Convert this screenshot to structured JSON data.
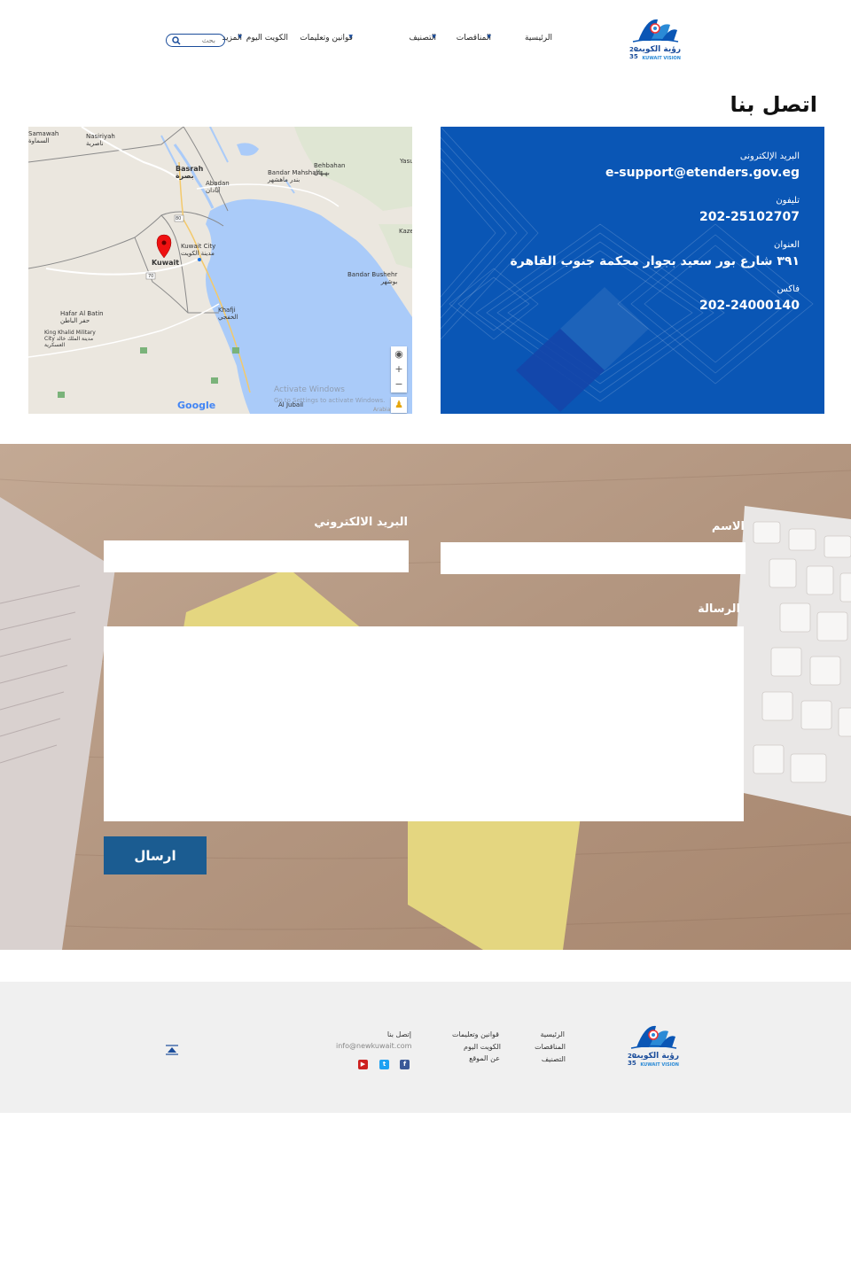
{
  "header": {
    "logo": {
      "arabic": "رؤية الكويت",
      "year_top": "20",
      "year_bottom": "35",
      "english": "KUWAIT VISION"
    },
    "nav": [
      {
        "label": "الرئيسية",
        "dropdown": false
      },
      {
        "label": "المناقصات",
        "dropdown": true
      },
      {
        "label": "التصنيف",
        "dropdown": true
      },
      {
        "label": "قوانين وتعليمات",
        "dropdown": true
      },
      {
        "label": "الكويت اليوم",
        "dropdown": false
      },
      {
        "label": "المزيد",
        "dropdown": true
      }
    ],
    "search_placeholder": "بحث"
  },
  "page_title": "اتصل بنا",
  "map": {
    "labels": {
      "samawah": "Samawah",
      "samawah_ar": "السماوة",
      "nasiriyah": "Nasiriyah",
      "nasiriyah_ar": "ناصرية",
      "basrah": "Basrah",
      "basrah_ar": "بصرة",
      "abadan": "Abadan",
      "abadan_ar": "آبادان",
      "bandar_mahshahr": "Bandar Mahshahr",
      "bandar_mahshahr_ar": "بندر ماهشهر",
      "behbahan": "Behbahan",
      "behbahan_ar": "بهبهان",
      "yasuj": "Yasu",
      "kaze": "Kaze",
      "kuwait_city": "Kuwait City",
      "kuwait_city_ar": "مدينة الكويت",
      "kuwait": "Kuwait",
      "bandar_bushehr": "Bandar Bushehr",
      "bandar_bushehr_ar": "بوشهر",
      "hafar": "Hafar Al Batin",
      "hafar_ar": "حفر الباطن",
      "king_khalid": "King Khalid Military City",
      "king_khalid_ar": "مدينة الملك خالد العسكرية",
      "khafji": "Khafji",
      "khafji_ar": "الخفجي",
      "al_jubail": "Al Jubail",
      "arabia": "Arabia",
      "road_80": "80",
      "road_70": "70"
    },
    "google": "Google",
    "watermark_line1": "Activate Windows",
    "watermark_line2": "Go to Settings to activate Windows."
  },
  "contact": {
    "email_label": "البريد الإلكترونى",
    "email_value": "e-support@etenders.gov.eg",
    "phone_label": "تليفون",
    "phone_value": "202-25102707",
    "address_label": "العنوان",
    "address_value": "٣٩١ شارع بور سعيد بجوار محكمة جنوب القاهرة",
    "fax_label": "فاكس",
    "fax_value": "202-24000140"
  },
  "form": {
    "name_label": "الاسم",
    "email_label": "البريد الالكتروني",
    "message_label": "الرسالة",
    "submit_label": "ارسال",
    "name_value": "",
    "email_value": "",
    "message_value": ""
  },
  "footer": {
    "links_col1": [
      "الرئيسية",
      "المناقصات",
      "التصنيف"
    ],
    "links_col2": [
      "قوانين وتعليمات",
      "الكويت اليوم",
      "عن الموقع"
    ],
    "contact_title": "إتصل بنا",
    "contact_email": "info@newkuwait.com",
    "social": [
      "facebook-icon",
      "twitter-icon",
      "youtube-icon"
    ],
    "colors": {
      "facebook": "#3b5998",
      "twitter": "#1da1f2",
      "youtube": "#cd201f"
    }
  },
  "colors": {
    "brand_blue": "#0a56b5",
    "button_blue": "#1b5c91",
    "nav_accent": "#1b4d9b"
  }
}
